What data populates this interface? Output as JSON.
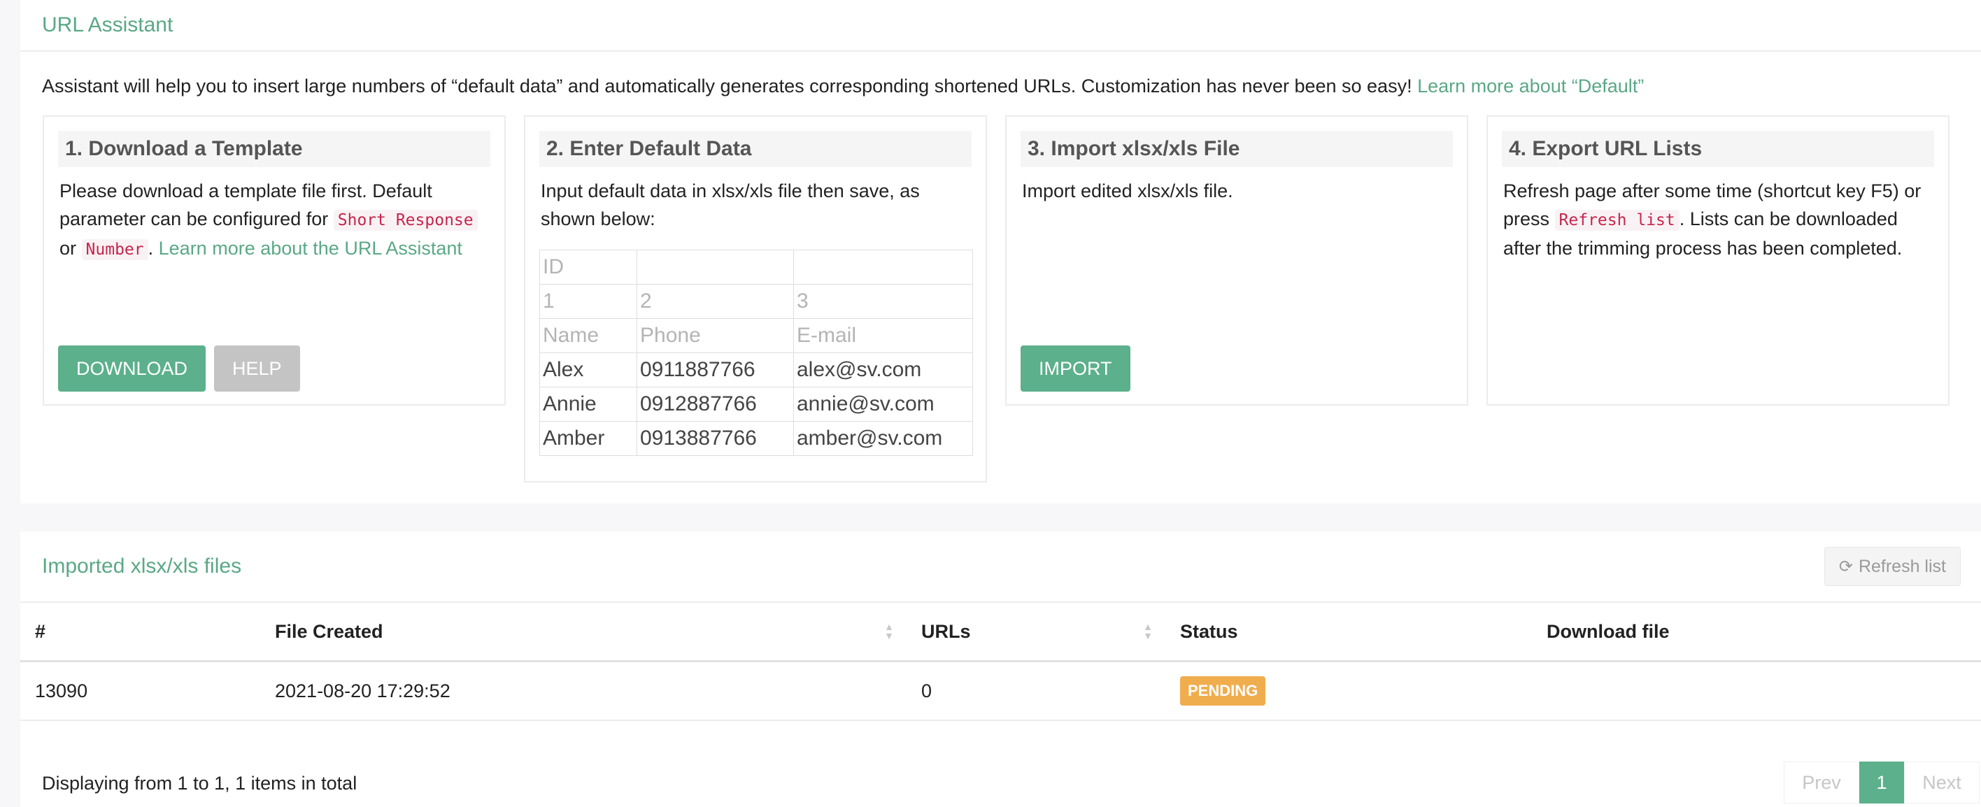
{
  "assistant": {
    "title": "URL Assistant",
    "intro": "Assistant will help you to insert large numbers of “default data” and automatically generates corresponding shortened URLs. Customization has never been so easy!",
    "intro_link": "Learn more about “Default”"
  },
  "steps": [
    {
      "title": "1. Download a Template",
      "text_1": "Please download a template file first. Default parameter can be configured for",
      "code_1": "Short Response",
      "or": "or",
      "code_2": "Number",
      "link": "Learn more about the URL Assistant",
      "download_label": "DOWNLOAD",
      "help_label": "HELP"
    },
    {
      "title": "2. Enter Default Data",
      "text": "Input default data in xlsx/xls file then save, as shown below:",
      "sample_rows": [
        [
          "ID",
          "",
          ""
        ],
        [
          "1",
          "2",
          "3"
        ],
        [
          "Name",
          "Phone",
          "E-mail"
        ],
        [
          "Alex",
          "0911887766",
          "alex@sv.com"
        ],
        [
          "Annie",
          "0912887766",
          "annie@sv.com"
        ],
        [
          "Amber",
          "0913887766",
          "amber@sv.com"
        ]
      ]
    },
    {
      "title": "3. Import xlsx/xls File",
      "text": "Import edited xlsx/xls file.",
      "import_label": "IMPORT"
    },
    {
      "title": "4. Export URL Lists",
      "text_1": "Refresh page after some time (shortcut key F5) or press",
      "code": "Refresh list",
      "text_2": ". Lists can be downloaded after the trimming process has been completed."
    }
  ],
  "imported": {
    "title": "Imported xlsx/xls files",
    "refresh_label": "Refresh list",
    "columns": [
      "#",
      "File Created",
      "URLs",
      "Status",
      "Download file"
    ],
    "rows": [
      {
        "id": "13090",
        "created": "2021-08-20 17:29:52",
        "urls": "0",
        "status": "PENDING",
        "download": ""
      }
    ],
    "footer": "Displaying from 1 to 1, 1 items in total",
    "pager": {
      "prev": "Prev",
      "current": "1",
      "next": "Next"
    }
  },
  "colors": {
    "accent": "#5cb08c",
    "pending": "#f0ad4e",
    "code": "#c7254e"
  }
}
